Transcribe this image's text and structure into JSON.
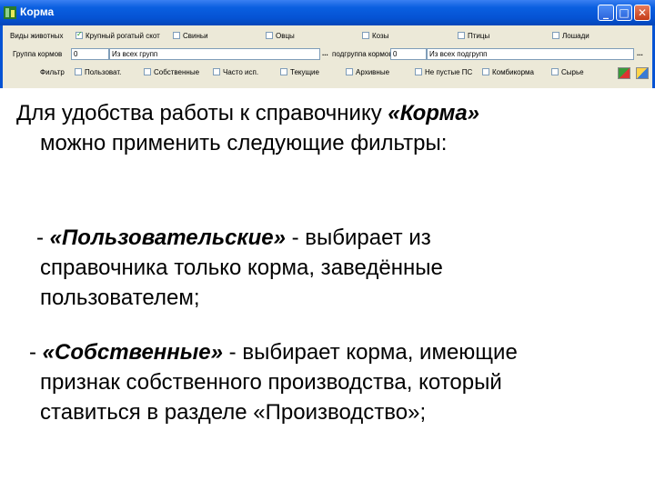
{
  "window": {
    "title": "Корма",
    "controls": {
      "minimize": "_",
      "maximize": "□",
      "close": "✕"
    }
  },
  "filter_panel": {
    "row1": {
      "label": "Виды животных",
      "options": [
        {
          "label": "Крупный рогатый скот",
          "checked": true
        },
        {
          "label": "Свиньи",
          "checked": false
        },
        {
          "label": "Овцы",
          "checked": false
        },
        {
          "label": "Козы",
          "checked": false
        },
        {
          "label": "Птицы",
          "checked": false
        },
        {
          "label": "Лошади",
          "checked": false
        }
      ]
    },
    "row2": {
      "group_label": "Группа кормов",
      "group_code": "0",
      "group_value": "Из всех групп",
      "subgroup_label": "подгруппа кормов",
      "subgroup_code": "0",
      "subgroup_value": "Из всех подгрупп",
      "ellipsis": "..."
    },
    "row3": {
      "label": "Фильтр",
      "options": [
        {
          "label": "Пользоват.",
          "checked": false
        },
        {
          "label": "Собственные",
          "checked": false
        },
        {
          "label": "Часто исп.",
          "checked": false
        },
        {
          "label": "Текущие",
          "checked": false
        },
        {
          "label": "Архивные",
          "checked": false
        },
        {
          "label": "Не пустые ПС",
          "checked": false
        },
        {
          "label": "Комбикорма",
          "checked": false
        },
        {
          "label": "Сырье",
          "checked": false
        }
      ]
    }
  },
  "slide": {
    "intro_line1_a": "Для удобства работы к справочнику ",
    "intro_line1_b": "«Корма»",
    "intro_line2": "можно применить следующие фильтры:",
    "item1_dash": "- ",
    "item1_term": "«Пользовательские»",
    "item1_line1_rest": " - выбирает из",
    "item1_line2": "справочника только корма, заведённые",
    "item1_line3": "пользователем;",
    "item2_dash": "- ",
    "item2_term": "«Собственные»",
    "item2_line1_rest": " - выбирает корма, имеющие",
    "item2_line2": "признак собственного производства, который",
    "item2_line3": "ставиться в разделе «Производство»;"
  }
}
